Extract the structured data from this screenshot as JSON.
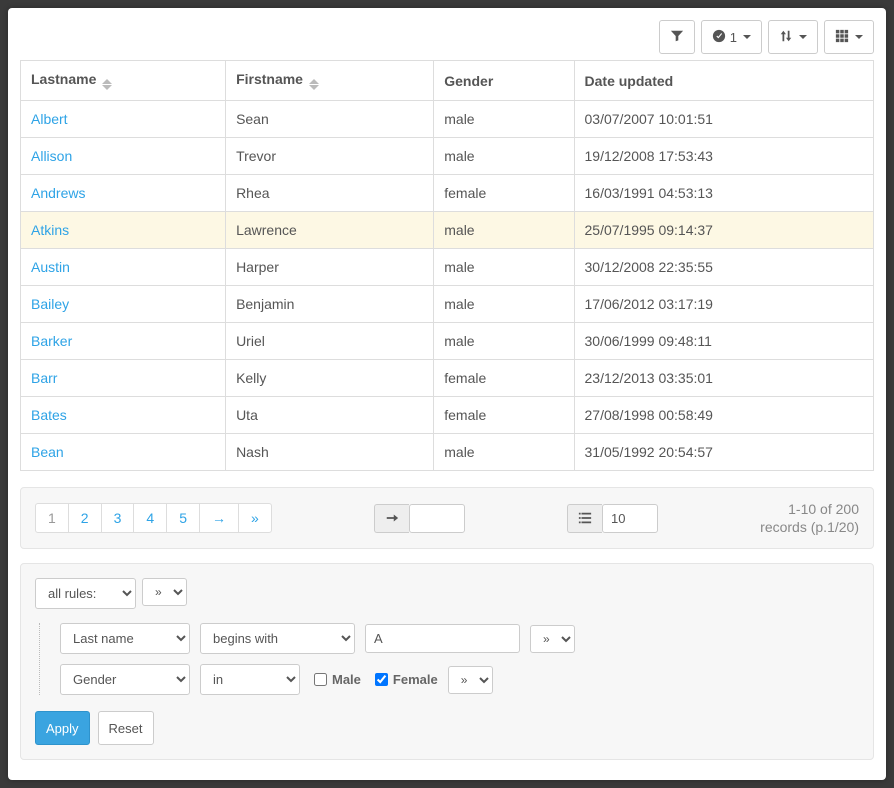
{
  "toolbar": {
    "selected_count": "1"
  },
  "columns": [
    {
      "label": "Lastname",
      "sortable": true
    },
    {
      "label": "Firstname",
      "sortable": true
    },
    {
      "label": "Gender",
      "sortable": false
    },
    {
      "label": "Date updated",
      "sortable": false
    }
  ],
  "rows": [
    {
      "lastname": "Albert",
      "firstname": "Sean",
      "gender": "male",
      "date": "03/07/2007 10:01:51"
    },
    {
      "lastname": "Allison",
      "firstname": "Trevor",
      "gender": "male",
      "date": "19/12/2008 17:53:43"
    },
    {
      "lastname": "Andrews",
      "firstname": "Rhea",
      "gender": "female",
      "date": "16/03/1991 04:53:13"
    },
    {
      "lastname": "Atkins",
      "firstname": "Lawrence",
      "gender": "male",
      "date": "25/07/1995 09:14:37",
      "highlight": true
    },
    {
      "lastname": "Austin",
      "firstname": "Harper",
      "gender": "male",
      "date": "30/12/2008 22:35:55"
    },
    {
      "lastname": "Bailey",
      "firstname": "Benjamin",
      "gender": "male",
      "date": "17/06/2012 03:17:19"
    },
    {
      "lastname": "Barker",
      "firstname": "Uriel",
      "gender": "male",
      "date": "30/06/1999 09:48:11"
    },
    {
      "lastname": "Barr",
      "firstname": "Kelly",
      "gender": "female",
      "date": "23/12/2013 03:35:01"
    },
    {
      "lastname": "Bates",
      "firstname": "Uta",
      "gender": "female",
      "date": "27/08/1998 00:58:49"
    },
    {
      "lastname": "Bean",
      "firstname": "Nash",
      "gender": "male",
      "date": "31/05/1992 20:54:57"
    }
  ],
  "pagination": {
    "pages": [
      "1",
      "2",
      "3",
      "4",
      "5",
      "→",
      "»"
    ],
    "active_index": 0,
    "goto_value": "",
    "page_size": "10",
    "records_line1": "1-10 of 200",
    "records_line2": "records (p.1/20)"
  },
  "filter": {
    "combinator_label": "all rules:",
    "add_group_label": "»",
    "rules": [
      {
        "field": "Last name",
        "op": "begins with",
        "value": "A"
      },
      {
        "field": "Gender",
        "op": "in",
        "options": {
          "male_label": "Male",
          "male_checked": false,
          "female_label": "Female",
          "female_checked": true
        }
      }
    ],
    "apply_label": "Apply",
    "reset_label": "Reset"
  }
}
